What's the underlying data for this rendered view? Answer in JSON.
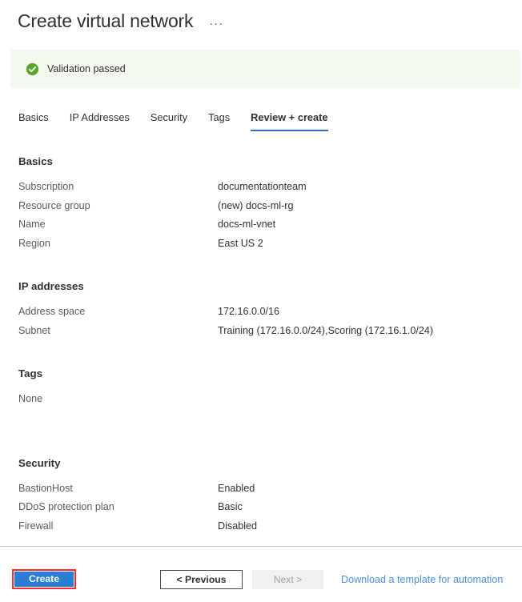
{
  "header": {
    "title": "Create virtual network",
    "ellipsis": "···"
  },
  "banner": {
    "icon": "check-circle-icon",
    "text": "Validation passed",
    "background_color": "#f3f9ef",
    "icon_color": "#5aa52b"
  },
  "tabs": [
    {
      "label": "Basics",
      "active": false
    },
    {
      "label": "IP Addresses",
      "active": false
    },
    {
      "label": "Security",
      "active": false
    },
    {
      "label": "Tags",
      "active": false
    },
    {
      "label": "Review + create",
      "active": true
    }
  ],
  "active_tab_underline_color": "#2f6fb5",
  "sections": [
    {
      "title": "Basics",
      "rows": [
        {
          "key": "Subscription",
          "value": "documentationteam"
        },
        {
          "key": "Resource group",
          "value": "(new) docs-ml-rg"
        },
        {
          "key": "Name",
          "value": "docs-ml-vnet"
        },
        {
          "key": "Region",
          "value": "East US 2"
        }
      ]
    },
    {
      "title": "IP addresses",
      "rows": [
        {
          "key": "Address space",
          "value": "172.16.0.0/16"
        },
        {
          "key": "Subnet",
          "value": "Training (172.16.0.0/24),Scoring (172.16.1.0/24)"
        }
      ]
    },
    {
      "title": "Tags",
      "single_value": "None",
      "rows": []
    },
    {
      "title": "Security",
      "rows": [
        {
          "key": "BastionHost",
          "value": "Enabled"
        },
        {
          "key": "DDoS protection plan",
          "value": "Basic"
        },
        {
          "key": "Firewall",
          "value": "Disabled"
        }
      ]
    }
  ],
  "footer": {
    "create_label": "Create",
    "previous_label": "< Previous",
    "next_label": "Next >",
    "download_link_label": "Download a template for automation",
    "create_button_color": "#2b7cd3",
    "highlight_color": "#f62b2b",
    "link_color": "#4a90d9"
  }
}
